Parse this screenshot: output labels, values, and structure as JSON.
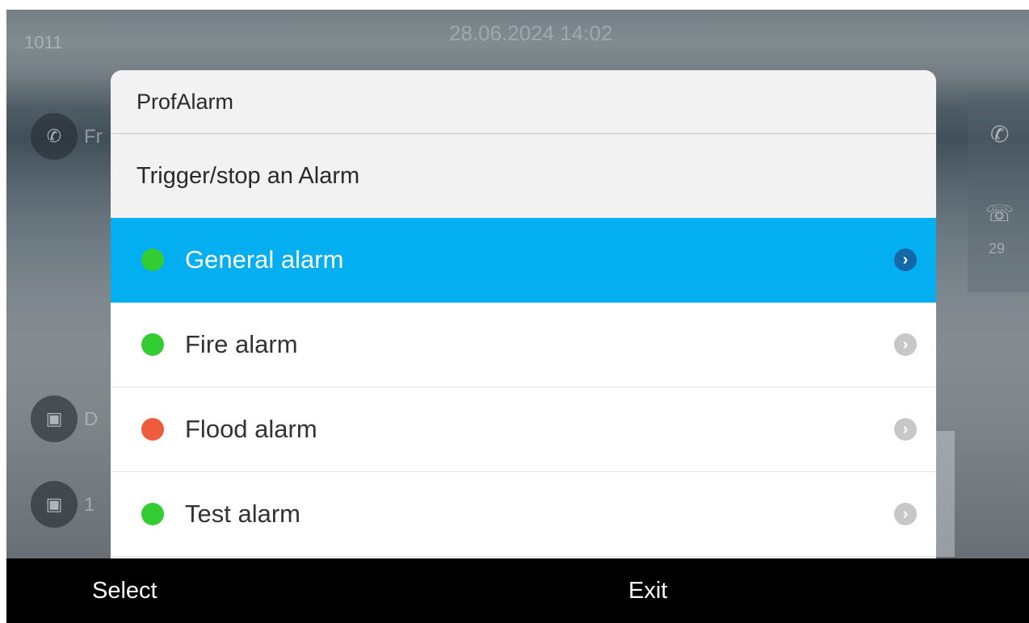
{
  "status_bar": {
    "extension": "1011",
    "datetime": "28.06.2024 14:02"
  },
  "background": {
    "line_1_label": "Fr",
    "line_2_label": "D",
    "line_3_label": "1",
    "missed_count": "29"
  },
  "dialog": {
    "title": "ProfAlarm",
    "subtitle": "Trigger/stop an Alarm",
    "items": [
      {
        "label": "General alarm",
        "status_color": "#33cc33",
        "selected": true
      },
      {
        "label": "Fire alarm",
        "status_color": "#33cc33",
        "selected": false
      },
      {
        "label": "Flood alarm",
        "status_color": "#ee5c3b",
        "selected": false
      },
      {
        "label": "Test alarm",
        "status_color": "#33cc33",
        "selected": false
      }
    ]
  },
  "softkeys": {
    "select_label": "Select",
    "exit_label": "Exit"
  },
  "colors": {
    "selection": "#04aff1",
    "softkey_bar": "#000000"
  },
  "icons": {
    "item_chevron": "chevron-right-icon",
    "status": "status-dot-icon"
  }
}
